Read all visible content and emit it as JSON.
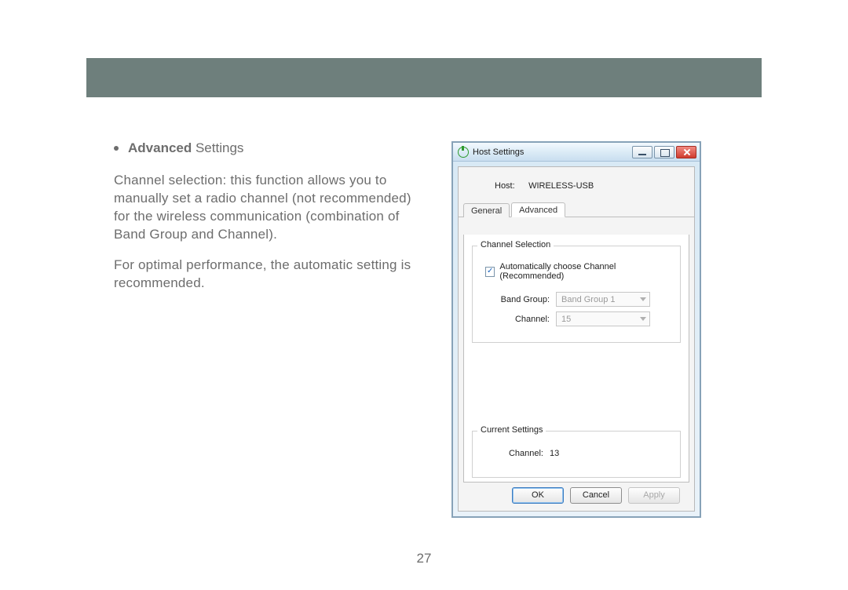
{
  "page_number": "27",
  "doc": {
    "heading_bold": "Advanced",
    "heading_rest": " Settings",
    "para1": "Channel selection: this function allows you to manually set a radio channel (not recommended) for the wireless communication (combination of Band Group and Channel).",
    "para2": "For optimal performance, the automatic setting is recommended."
  },
  "dialog": {
    "title": "Host Settings",
    "host_label": "Host:",
    "host_value": "WIRELESS-USB",
    "tabs": {
      "general": "General",
      "advanced": "Advanced"
    },
    "group_channel_selection": "Channel Selection",
    "auto_choose_label": "Automatically choose Channel (Recommended)",
    "band_group_label": "Band Group:",
    "band_group_value": "Band Group 1",
    "channel_label": "Channel:",
    "channel_value": "15",
    "group_current": "Current Settings",
    "current_channel_label": "Channel:",
    "current_channel_value": "13",
    "buttons": {
      "ok": "OK",
      "cancel": "Cancel",
      "apply": "Apply"
    }
  }
}
